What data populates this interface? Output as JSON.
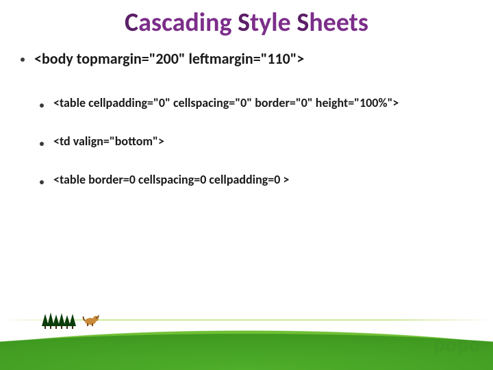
{
  "title": {
    "c1": "C",
    "r1": "ascading ",
    "c2": "S",
    "r2": "tyle ",
    "c3": "S",
    "r3": "heets"
  },
  "bullets": {
    "b1": "<body topmargin=\"200\" leftmargin=\"110\">",
    "b2": "<table cellpadding=\"0\" cellspacing=\"0\" border=\"0\" height=\"100%\">",
    "b3": "<td valign=\"bottom\">",
    "b4": "<table border=0 cellspacing=0 cellpadding=0 >"
  },
  "watermark": "popo"
}
